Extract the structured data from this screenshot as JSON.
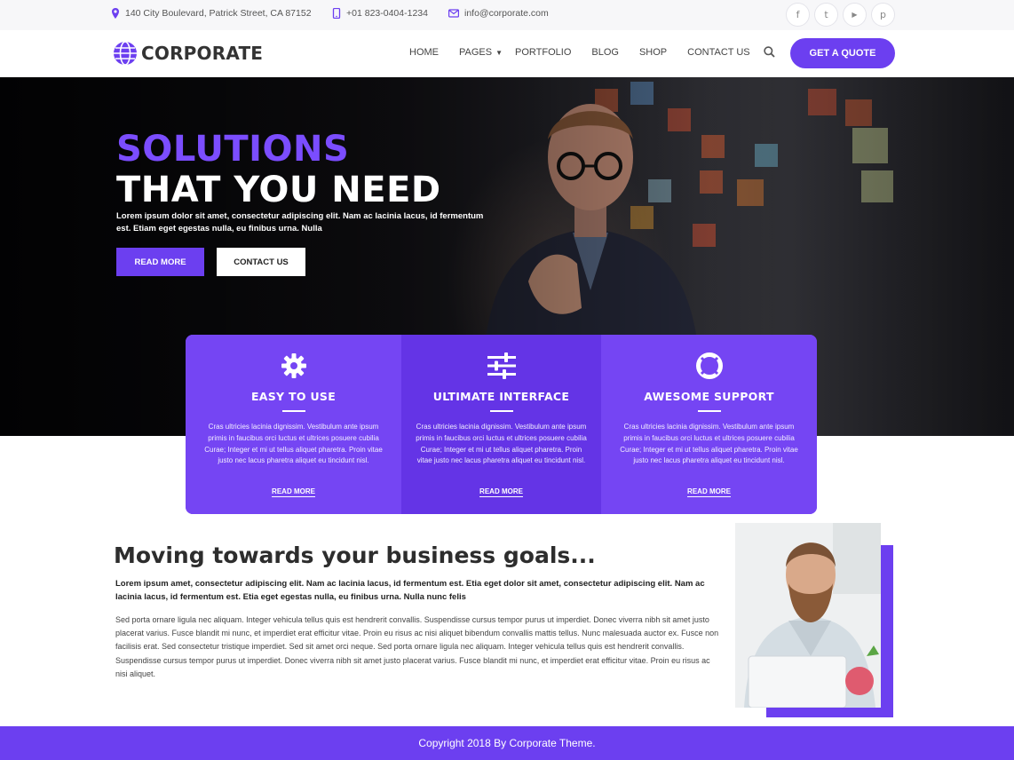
{
  "topbar": {
    "address": "140 City Boulevard, Patrick Street, CA 87152",
    "phone": "+01 823-0404-1234",
    "email": "info@corporate.com",
    "socials": [
      {
        "icon": "facebook-icon",
        "glyph": "f"
      },
      {
        "icon": "twitter-icon",
        "glyph": "t"
      },
      {
        "icon": "youtube-icon",
        "glyph": "▶"
      },
      {
        "icon": "pinterest-icon",
        "glyph": "p"
      }
    ]
  },
  "header": {
    "logo_text": "CORPORATE",
    "menu": [
      "HOME",
      "PAGES",
      "PORTFOLIO",
      "BLOG",
      "SHOP",
      "CONTACT US"
    ],
    "quote_button": "GET A QUOTE"
  },
  "hero": {
    "title_line1": "SOLUTIONS",
    "title_line2": "THAT YOU NEED",
    "description": "Lorem ipsum dolor sit amet, consectetur adipiscing elit. Nam ac lacinia lacus, id fermentum est. Etiam eget egestas nulla, eu finibus urna. Nulla",
    "primary_button": "READ MORE",
    "secondary_button": "CONTACT US"
  },
  "features": [
    {
      "icon": "gear-icon",
      "title": "EASY TO USE",
      "text": "Cras ultricies lacinia dignissim. Vestibulum ante ipsum primis in faucibus orci luctus et ultrices posuere cubilia Curae; Integer et mi ut tellus aliquet pharetra. Proin vitae justo nec lacus pharetra aliquet eu tincidunt nisl.",
      "link": "READ MORE"
    },
    {
      "icon": "sliders-icon",
      "title": "ULTIMATE INTERFACE",
      "text": "Cras ultricies lacinia dignissim. Vestibulum ante ipsum primis in faucibus orci luctus et ultrices posuere cubilia Curae; Integer et mi ut tellus aliquet pharetra. Proin vitae justo nec lacus pharetra aliquet eu tincidunt nisl.",
      "link": "READ MORE"
    },
    {
      "icon": "lifebuoy-icon",
      "title": "AWESOME SUPPORT",
      "text": "Cras ultricies lacinia dignissim. Vestibulum ante ipsum primis in faucibus orci luctus et ultrices posuere cubilia Curae; Integer et mi ut tellus aliquet pharetra. Proin vitae justo nec lacus pharetra aliquet eu tincidunt nisl.",
      "link": "READ MORE"
    }
  ],
  "about": {
    "title": "Moving towards your business goals...",
    "lead": "Lorem ipsum  amet, consectetur adipiscing elit. Nam ac lacinia lacus, id fermentum est. Etia  eget dolor sit amet, consectetur adipiscing elit. Nam ac lacinia lacus, id fermentum est. Etia  eget egestas nulla, eu finibus urna. Nulla nunc felis",
    "body": "Sed porta ornare ligula nec aliquam. Integer vehicula tellus quis est hendrerit convallis. Suspendisse cursus tempor purus ut imperdiet. Donec viverra nibh sit amet justo placerat varius. Fusce blandit mi nunc, et imperdiet erat efficitur vitae. Proin eu risus ac nisi aliquet bibendum convallis mattis tellus. Nunc malesuada auctor ex. Fusce non facilisis erat. Sed consectetur tristique imperdiet. Sed sit amet orci neque. Sed porta ornare ligula nec aliquam. Integer vehicula tellus quis est hendrerit convallis. Suspendisse cursus tempor purus ut imperdiet. Donec viverra nibh sit amet justo placerat varius. Fusce blandit mi nunc, et imperdiet erat efficitur vitae. Proin eu risus ac nisi aliquet."
  },
  "footer": {
    "copyright": "Copyright 2018 By Corporate Theme."
  },
  "colors": {
    "accent": "#6c3ff0",
    "feature_panel": "#7545f3",
    "feature_panel_alt": "#6434e6"
  }
}
